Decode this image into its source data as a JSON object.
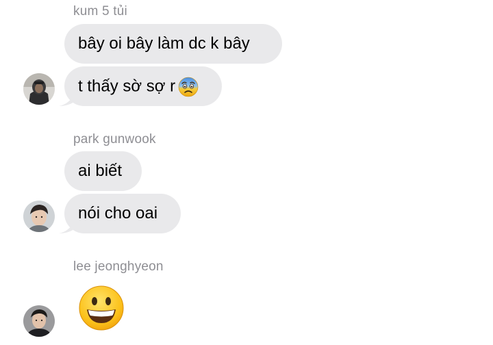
{
  "groups": [
    {
      "sender": "kum 5 tủi",
      "messages": [
        "bây oi bây làm dc k bây",
        "t thấy sờ sợ r"
      ],
      "avatar_icon": "user-avatar-hooded"
    },
    {
      "sender": "park gunwook",
      "messages": [
        "ai biết",
        "nói cho oai"
      ],
      "avatar_icon": "user-avatar-portrait"
    },
    {
      "sender": "lee jeonghyeon",
      "messages": [],
      "avatar_icon": "user-avatar-portrait-dark"
    }
  ],
  "emojis": {
    "fearful": "fearful-face-emoji",
    "grinning": "grinning-face-emoji"
  },
  "colors": {
    "bubble": "#e9e9eb",
    "sender_name": "#8e8e93",
    "text": "#000000",
    "background": "#ffffff"
  }
}
